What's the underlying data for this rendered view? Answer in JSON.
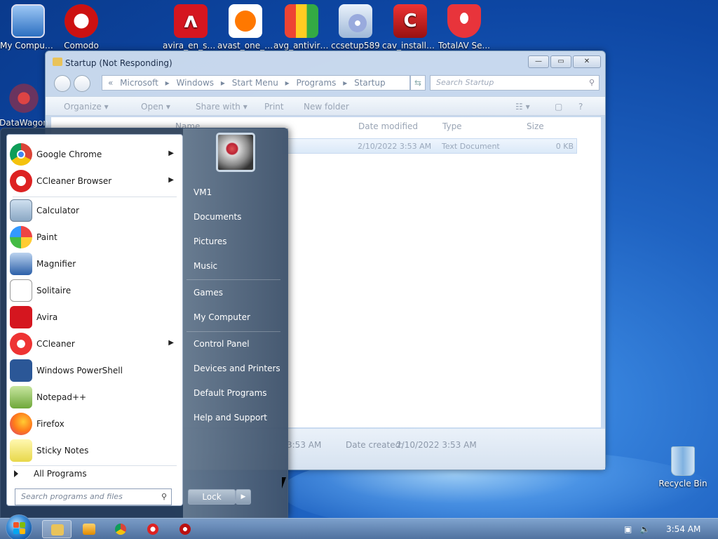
{
  "desktop": {
    "icons": [
      {
        "label": "My Computer"
      },
      {
        "label": "Comodo"
      },
      {
        "label": "avira_en_spt..."
      },
      {
        "label": "avast_one_e..."
      },
      {
        "label": "avg_antiviru..."
      },
      {
        "label": "ccsetup589"
      },
      {
        "label": "cav_installe..."
      },
      {
        "label": "TotalAV Se..."
      },
      {
        "label": "DataWagon"
      },
      {
        "label": "Recycle Bin"
      }
    ]
  },
  "explorer": {
    "title": "Startup (Not Responding)",
    "address_prefix": "«",
    "address": [
      "Microsoft",
      "▸",
      "Windows",
      "▸",
      "Start Menu",
      "▸",
      "Programs",
      "▸",
      "Startup"
    ],
    "search_placeholder": "Search Startup",
    "toolbar": {
      "organize": "Organize ▾",
      "open": "Open ▾",
      "share": "Share with ▾",
      "print": "Print",
      "new_folder": "New folder"
    },
    "columns": {
      "name": "Name",
      "date_modified": "Date modified",
      "type": "Type",
      "size": "Size"
    },
    "file_row": {
      "date": "2/10/2022 3:53 AM",
      "type": "Text Document",
      "size": "0 KB"
    },
    "details": {
      "modified_tail": "3:53 AM",
      "created_label": "Date created:",
      "created_value": "2/10/2022 3:53 AM"
    }
  },
  "start_menu": {
    "pinned": [
      {
        "label": "Google Chrome",
        "has_arrow": true
      },
      {
        "label": "CCleaner Browser",
        "has_arrow": true
      }
    ],
    "recent": [
      {
        "label": "Calculator"
      },
      {
        "label": "Paint"
      },
      {
        "label": "Magnifier"
      },
      {
        "label": "Solitaire"
      },
      {
        "label": "Avira"
      },
      {
        "label": "CCleaner",
        "has_arrow": true
      },
      {
        "label": "Windows PowerShell"
      },
      {
        "label": "Notepad++"
      },
      {
        "label": "Firefox"
      },
      {
        "label": "Sticky Notes"
      }
    ],
    "all_programs": "All Programs",
    "search_placeholder": "Search programs and files",
    "right_items": [
      "VM1",
      "Documents",
      "Pictures",
      "Music",
      "Games",
      "My Computer",
      "Control Panel",
      "Devices and Printers",
      "Default Programs",
      "Help and Support"
    ],
    "lock": "Lock",
    "lock_arrow": "▶"
  },
  "taskbar": {
    "clock": "3:54 AM"
  }
}
